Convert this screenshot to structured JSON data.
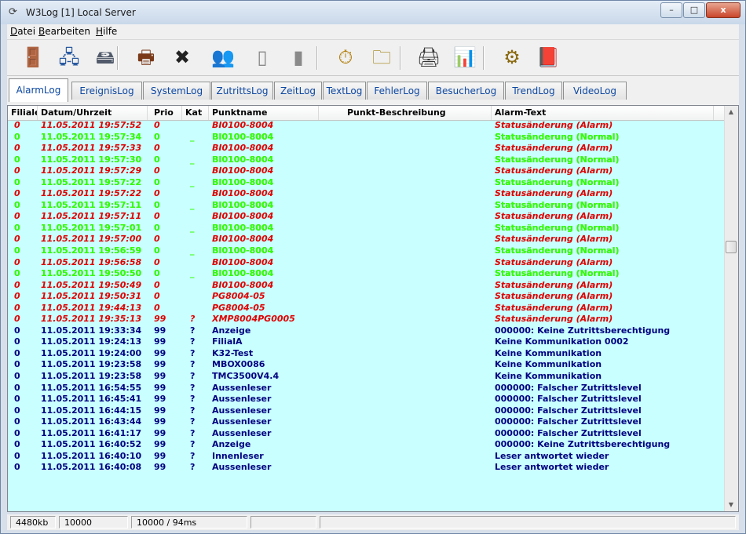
{
  "window": {
    "title": "W3Log [1] Local Server",
    "minimize": "–",
    "maximize": "□",
    "close": "x"
  },
  "menu": [
    {
      "underlined": "D",
      "rest": "atei"
    },
    {
      "underlined": "B",
      "rest": "earbeiten"
    },
    {
      "underlined": "H",
      "rest": "ilfe"
    }
  ],
  "toolbar": [
    {
      "icon": "exit-door-icon",
      "glyph": "🚪"
    },
    {
      "icon": "network-computer-icon",
      "glyph": "🖧"
    },
    {
      "icon": "server-disk-icon",
      "glyph": "🖴"
    },
    {
      "icon": "print-preview-icon",
      "glyph": "🖶"
    },
    {
      "icon": "delete-cross-icon",
      "glyph": "✖"
    },
    {
      "icon": "operators-icon",
      "glyph": "👥"
    },
    {
      "icon": "document-gray-icon",
      "glyph": "▯"
    },
    {
      "icon": "block-gray-icon",
      "glyph": "▮"
    },
    {
      "icon": "stopwatch-icon",
      "glyph": "⏱"
    },
    {
      "icon": "folder-add-icon",
      "glyph": "🗀"
    },
    {
      "icon": "printer-icon",
      "glyph": "🖨"
    },
    {
      "icon": "excel-export-icon",
      "glyph": "📊"
    },
    {
      "icon": "settings-gears-icon",
      "glyph": "⚙"
    },
    {
      "icon": "help-book-icon",
      "glyph": "📕"
    }
  ],
  "tabs": [
    "AlarmLog",
    "EreignisLog",
    "SystemLog",
    "ZutrittsLog",
    "ZeitLog",
    "TextLog",
    "FehlerLog",
    "BesucherLog",
    "TrendLog",
    "VideoLog"
  ],
  "active_tab": "AlarmLog",
  "columns": [
    "Filiale",
    "Datum/Uhrzeit",
    "Prio",
    "Kat",
    "Punktname",
    "Punkt-Beschreibung",
    "Alarm-Text"
  ],
  "rows": [
    {
      "style": "red",
      "filiale": "0",
      "datum": "11.05.2011 19:57:52",
      "prio": "0",
      "kat": "",
      "punkt": "BI0100-8004",
      "beschr": "",
      "text": "Statusänderung (Alarm)"
    },
    {
      "style": "green",
      "filiale": "0",
      "datum": "11.05.2011 19:57:34",
      "prio": "0",
      "kat": "_",
      "punkt": "BI0100-8004",
      "beschr": "",
      "text": "Statusänderung (Normal)"
    },
    {
      "style": "red",
      "filiale": "0",
      "datum": "11.05.2011 19:57:33",
      "prio": "0",
      "kat": "",
      "punkt": "BI0100-8004",
      "beschr": "",
      "text": "Statusänderung (Alarm)"
    },
    {
      "style": "green",
      "filiale": "0",
      "datum": "11.05.2011 19:57:30",
      "prio": "0",
      "kat": "_",
      "punkt": "BI0100-8004",
      "beschr": "",
      "text": "Statusänderung (Normal)"
    },
    {
      "style": "red",
      "filiale": "0",
      "datum": "11.05.2011 19:57:29",
      "prio": "0",
      "kat": "",
      "punkt": "BI0100-8004",
      "beschr": "",
      "text": "Statusänderung (Alarm)"
    },
    {
      "style": "green",
      "filiale": "0",
      "datum": "11.05.2011 19:57:22",
      "prio": "0",
      "kat": "_",
      "punkt": "BI0100-8004",
      "beschr": "",
      "text": "Statusänderung (Normal)"
    },
    {
      "style": "red",
      "filiale": "0",
      "datum": "11.05.2011 19:57:22",
      "prio": "0",
      "kat": "",
      "punkt": "BI0100-8004",
      "beschr": "",
      "text": "Statusänderung (Alarm)"
    },
    {
      "style": "green",
      "filiale": "0",
      "datum": "11.05.2011 19:57:11",
      "prio": "0",
      "kat": "_",
      "punkt": "BI0100-8004",
      "beschr": "",
      "text": "Statusänderung (Normal)"
    },
    {
      "style": "red",
      "filiale": "0",
      "datum": "11.05.2011 19:57:11",
      "prio": "0",
      "kat": "",
      "punkt": "BI0100-8004",
      "beschr": "",
      "text": "Statusänderung (Alarm)"
    },
    {
      "style": "green",
      "filiale": "0",
      "datum": "11.05.2011 19:57:01",
      "prio": "0",
      "kat": "_",
      "punkt": "BI0100-8004",
      "beschr": "",
      "text": "Statusänderung (Normal)"
    },
    {
      "style": "red",
      "filiale": "0",
      "datum": "11.05.2011 19:57:00",
      "prio": "0",
      "kat": "",
      "punkt": "BI0100-8004",
      "beschr": "",
      "text": "Statusänderung (Alarm)"
    },
    {
      "style": "green",
      "filiale": "0",
      "datum": "11.05.2011 19:56:59",
      "prio": "0",
      "kat": "_",
      "punkt": "BI0100-8004",
      "beschr": "",
      "text": "Statusänderung (Normal)"
    },
    {
      "style": "red",
      "filiale": "0",
      "datum": "11.05.2011 19:56:58",
      "prio": "0",
      "kat": "",
      "punkt": "BI0100-8004",
      "beschr": "",
      "text": "Statusänderung (Alarm)"
    },
    {
      "style": "green",
      "filiale": "0",
      "datum": "11.05.2011 19:50:50",
      "prio": "0",
      "kat": "_",
      "punkt": "BI0100-8004",
      "beschr": "",
      "text": "Statusänderung (Normal)"
    },
    {
      "style": "red",
      "filiale": "0",
      "datum": "11.05.2011 19:50:49",
      "prio": "0",
      "kat": "",
      "punkt": "BI0100-8004",
      "beschr": "",
      "text": "Statusänderung (Alarm)"
    },
    {
      "style": "red",
      "filiale": "0",
      "datum": "11.05.2011 19:50:31",
      "prio": "0",
      "kat": "",
      "punkt": "PG8004-05",
      "beschr": "",
      "text": "Statusänderung (Alarm)"
    },
    {
      "style": "red",
      "filiale": "0",
      "datum": "11.05.2011 19:44:13",
      "prio": "0",
      "kat": "",
      "punkt": "PG8004-05",
      "beschr": "",
      "text": "Statusänderung (Alarm)"
    },
    {
      "style": "red",
      "filiale": "0",
      "datum": "11.05.2011 19:35:13",
      "prio": "99",
      "kat": "?",
      "punkt": "XMP8004PG0005",
      "beschr": "",
      "text": "Statusänderung (Alarm)"
    },
    {
      "style": "blue",
      "filiale": "0",
      "datum": "11.05.2011 19:33:34",
      "prio": "99",
      "kat": "?",
      "punkt": "Anzeige",
      "beschr": "",
      "text": "000000: Keine Zutrittsberechtigung"
    },
    {
      "style": "blue",
      "filiale": "0",
      "datum": "11.05.2011 19:24:13",
      "prio": "99",
      "kat": "?",
      "punkt": "FilialA",
      "beschr": "",
      "text": "Keine Kommunikation 0002"
    },
    {
      "style": "blue",
      "filiale": "0",
      "datum": "11.05.2011 19:24:00",
      "prio": "99",
      "kat": "?",
      "punkt": "K32-Test",
      "beschr": "",
      "text": "Keine Kommunikation"
    },
    {
      "style": "blue",
      "filiale": "0",
      "datum": "11.05.2011 19:23:58",
      "prio": "99",
      "kat": "?",
      "punkt": "MBOX0086",
      "beschr": "",
      "text": "Keine Kommunikation"
    },
    {
      "style": "blue",
      "filiale": "0",
      "datum": "11.05.2011 19:23:58",
      "prio": "99",
      "kat": "?",
      "punkt": "TMC3500V4.4",
      "beschr": "",
      "text": "Keine Kommunikation"
    },
    {
      "style": "blue",
      "filiale": "0",
      "datum": "11.05.2011 16:54:55",
      "prio": "99",
      "kat": "?",
      "punkt": "Aussenleser",
      "beschr": "",
      "text": "000000: Falscher Zutrittslevel"
    },
    {
      "style": "blue",
      "filiale": "0",
      "datum": "11.05.2011 16:45:41",
      "prio": "99",
      "kat": "?",
      "punkt": "Aussenleser",
      "beschr": "",
      "text": "000000: Falscher Zutrittslevel"
    },
    {
      "style": "blue",
      "filiale": "0",
      "datum": "11.05.2011 16:44:15",
      "prio": "99",
      "kat": "?",
      "punkt": "Aussenleser",
      "beschr": "",
      "text": "000000: Falscher Zutrittslevel"
    },
    {
      "style": "blue",
      "filiale": "0",
      "datum": "11.05.2011 16:43:44",
      "prio": "99",
      "kat": "?",
      "punkt": "Aussenleser",
      "beschr": "",
      "text": "000000: Falscher Zutrittslevel"
    },
    {
      "style": "blue",
      "filiale": "0",
      "datum": "11.05.2011 16:41:17",
      "prio": "99",
      "kat": "?",
      "punkt": "Aussenleser",
      "beschr": "",
      "text": "000000: Falscher Zutrittslevel"
    },
    {
      "style": "blue",
      "filiale": "0",
      "datum": "11.05.2011 16:40:52",
      "prio": "99",
      "kat": "?",
      "punkt": "Anzeige",
      "beschr": "",
      "text": "000000: Keine Zutrittsberechtigung"
    },
    {
      "style": "blue",
      "filiale": "0",
      "datum": "11.05.2011 16:40:10",
      "prio": "99",
      "kat": "?",
      "punkt": "Innenleser",
      "beschr": "",
      "text": "Leser antwortet wieder"
    },
    {
      "style": "blue",
      "filiale": "0",
      "datum": "11.05.2011 16:40:08",
      "prio": "99",
      "kat": "?",
      "punkt": "Aussenleser",
      "beschr": "",
      "text": "Leser antwortet wieder"
    }
  ],
  "status": [
    "4480kb",
    "10000",
    "10000 / 94ms",
    "",
    ""
  ],
  "colors": {
    "grid_bg": "#c9ffff",
    "alarm": "#e00000",
    "normal": "#33ff00",
    "info": "#000080",
    "tab_text": "#0c47a1"
  }
}
